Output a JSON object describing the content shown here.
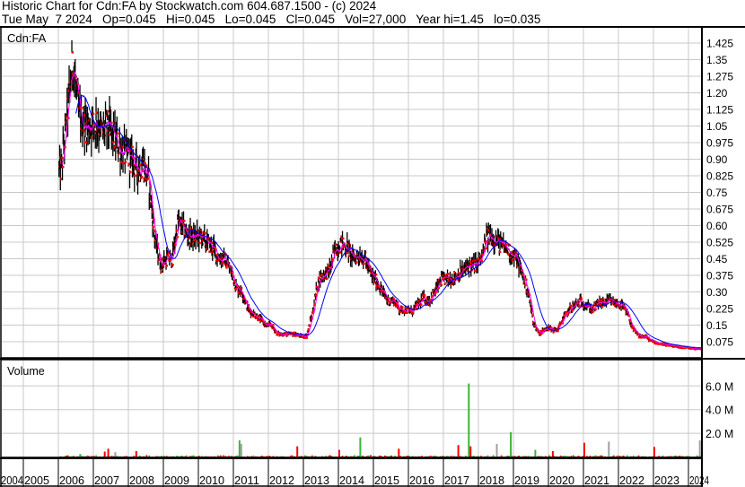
{
  "header": {
    "title": "Historic Chart for Cdn:FA by Stockwatch.com 604.687.1500 - (c) 2024",
    "quote": "Tue May  7 2024   Op=0.045   Hi=0.045   Lo=0.045   Cl=0.045   Vol=27,000   Year hi=1.45   lo=0.035"
  },
  "colors": {
    "grid": "#c8c8c8",
    "bar": "#000000",
    "close_dot": "#ff0000",
    "ma_short": "#ff00ff",
    "ma_long": "#0000ff",
    "vol_up": "#3cb43c",
    "vol_down": "#ff0000",
    "vol_flat": "#a0a0a0"
  },
  "chart_data": [
    {
      "type": "line",
      "title": "Cdn:FA",
      "ylim": [
        0,
        1.5
      ],
      "y_ticks": [
        "1.425",
        "1.35",
        "1.275",
        "1.20",
        "1.125",
        "1.05",
        "0.975",
        "0.90",
        "0.825",
        "0.75",
        "0.675",
        "0.60",
        "0.525",
        "0.45",
        "0.375",
        "0.30",
        "0.225",
        "0.15",
        "0.075"
      ],
      "x_start_year": 2006,
      "points_per_year": 6,
      "closes": [
        0.85,
        1.1,
        1.35,
        1.1,
        1.05,
        1.05,
        1.08,
        1.02,
        1.05,
        1.0,
        0.95,
        0.92,
        0.9,
        0.85,
        0.88,
        0.8,
        0.55,
        0.42,
        0.45,
        0.45,
        0.62,
        0.58,
        0.55,
        0.55,
        0.55,
        0.52,
        0.5,
        0.45,
        0.45,
        0.4,
        0.32,
        0.3,
        0.22,
        0.2,
        0.18,
        0.15,
        0.15,
        0.11,
        0.11,
        0.11,
        0.11,
        0.1,
        0.1,
        0.2,
        0.35,
        0.38,
        0.4,
        0.5,
        0.52,
        0.5,
        0.45,
        0.47,
        0.45,
        0.38,
        0.35,
        0.3,
        0.26,
        0.26,
        0.22,
        0.22,
        0.21,
        0.24,
        0.27,
        0.26,
        0.3,
        0.35,
        0.36,
        0.36,
        0.38,
        0.4,
        0.42,
        0.42,
        0.45,
        0.55,
        0.55,
        0.52,
        0.5,
        0.48,
        0.45,
        0.38,
        0.3,
        0.15,
        0.11,
        0.14,
        0.13,
        0.13,
        0.18,
        0.22,
        0.24,
        0.26,
        0.24,
        0.22,
        0.25,
        0.25,
        0.26,
        0.25,
        0.24,
        0.2,
        0.13,
        0.1,
        0.1,
        0.08,
        0.07,
        0.065,
        0.06,
        0.055,
        0.05,
        0.05,
        0.045,
        0.045
      ],
      "moving_averages": [
        {
          "name": "short",
          "color": "#ff00ff"
        },
        {
          "name": "long",
          "color": "#0000ff"
        }
      ]
    },
    {
      "type": "bar",
      "title": "Volume",
      "ylim": [
        0,
        7.5
      ],
      "unit": "M",
      "y_ticks": [
        "6.0 M",
        "4.0 M",
        "2.0 M"
      ],
      "spikes": [
        {
          "year": 2006.6,
          "value": 0.25,
          "dir": "up"
        },
        {
          "year": 2007.3,
          "value": 0.45,
          "dir": "down"
        },
        {
          "year": 2007.4,
          "value": 0.7,
          "dir": "down"
        },
        {
          "year": 2007.6,
          "value": 0.4,
          "dir": "flat"
        },
        {
          "year": 2008.2,
          "value": 0.5,
          "dir": "down"
        },
        {
          "year": 2011.15,
          "value": 1.4,
          "dir": "up"
        },
        {
          "year": 2011.2,
          "value": 1.1,
          "dir": "flat"
        },
        {
          "year": 2012.8,
          "value": 0.9,
          "dir": "down"
        },
        {
          "year": 2014.0,
          "value": 0.6,
          "dir": "down"
        },
        {
          "year": 2014.6,
          "value": 1.65,
          "dir": "up"
        },
        {
          "year": 2015.7,
          "value": 0.7,
          "dir": "down"
        },
        {
          "year": 2017.4,
          "value": 1.0,
          "dir": "down"
        },
        {
          "year": 2017.7,
          "value": 6.2,
          "dir": "up"
        },
        {
          "year": 2017.75,
          "value": 0.9,
          "dir": "down"
        },
        {
          "year": 2018.5,
          "value": 1.1,
          "dir": "flat"
        },
        {
          "year": 2018.9,
          "value": 2.1,
          "dir": "up"
        },
        {
          "year": 2019.6,
          "value": 0.6,
          "dir": "up"
        },
        {
          "year": 2020.1,
          "value": 0.5,
          "dir": "down"
        },
        {
          "year": 2021.0,
          "value": 1.2,
          "dir": "down"
        },
        {
          "year": 2021.7,
          "value": 1.3,
          "dir": "flat"
        },
        {
          "year": 2023.0,
          "value": 0.85,
          "dir": "down"
        },
        {
          "year": 2024.3,
          "value": 1.4,
          "dir": "flat"
        }
      ]
    }
  ],
  "x_axis": {
    "years": [
      "2004",
      "2005",
      "2006",
      "2007",
      "2008",
      "2009",
      "2010",
      "2011",
      "2012",
      "2013",
      "2014",
      "2015",
      "2016",
      "2017",
      "2018",
      "2019",
      "2020",
      "2021",
      "2022",
      "2023",
      "2024"
    ]
  }
}
